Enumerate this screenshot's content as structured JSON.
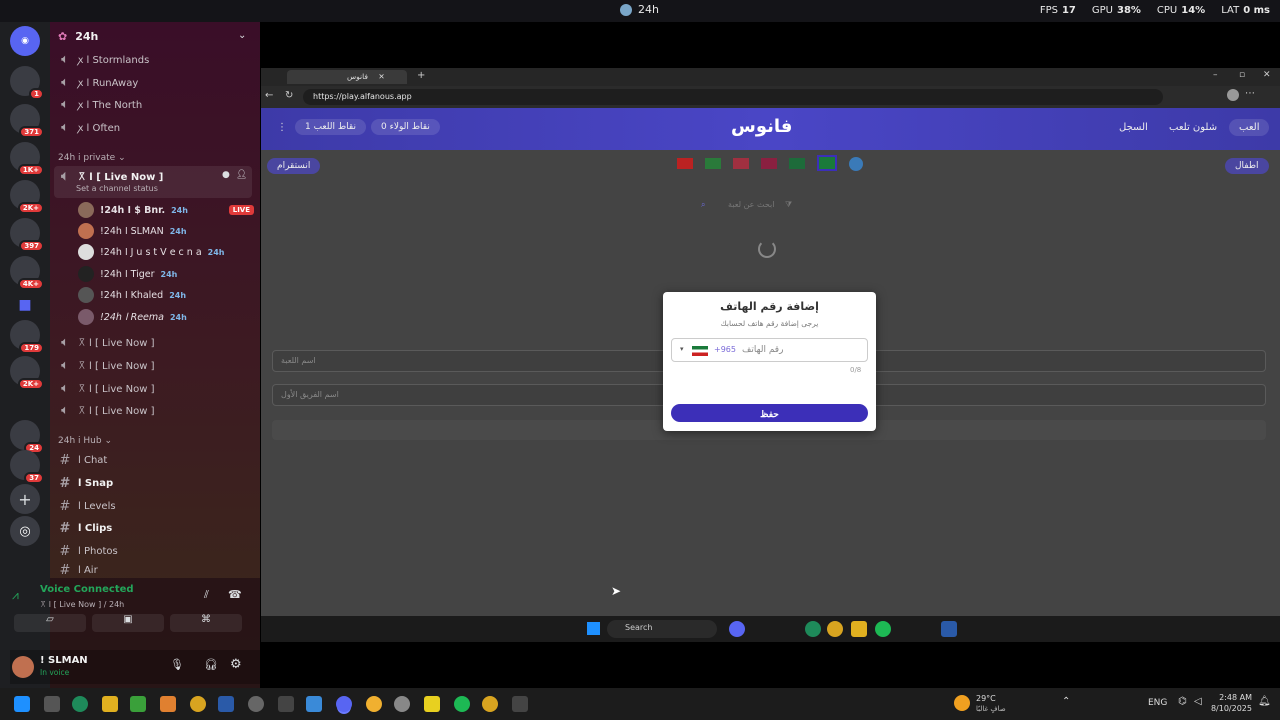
{
  "overlay": {
    "center_label": "24h",
    "stats": [
      {
        "label": "FPS",
        "value": "17"
      },
      {
        "label": "GPU",
        "value": "38%"
      },
      {
        "label": "CPU",
        "value": "14%"
      },
      {
        "label": "LAT",
        "value": "0 ms"
      }
    ]
  },
  "servers": {
    "badges": [
      "1",
      "371",
      "1K+",
      "2K+",
      "397",
      "4K+",
      "179",
      "2K+",
      "24",
      "37"
    ]
  },
  "sidebar": {
    "server_name": "24h",
    "top_channels": [
      "ꭗ ا Stormlands",
      "ꭗ ا RunAway",
      "ꭗ ا The North",
      "ꭗ ا Often"
    ],
    "category_private": "24h i private",
    "active_channel": "꓃ ا [ Live Now ]",
    "channel_status": "Set a channel status",
    "members": [
      {
        "name": "!24h ا $ Bnr.",
        "tag": "24h",
        "live": "LIVE"
      },
      {
        "name": "!24h ا SLMAN",
        "tag": "24h"
      },
      {
        "name": "!24h ا J u s t V e c n a",
        "tag": "24h"
      },
      {
        "name": "!24h ا Tiger",
        "tag": "24h"
      },
      {
        "name": "!24h ا Khaled",
        "tag": "24h"
      },
      {
        "name": "!24h ا Reema",
        "tag": "24h"
      }
    ],
    "live_channels": [
      "꓃ ا [ Live Now ]",
      "꓃ ا [ Live Now ]",
      "꓃ ا [ Live Now ]",
      "꓃ ا [ Live Now ]"
    ],
    "category_hub": "24h i Hub",
    "hub_channels": [
      "ا Chat",
      "ا Snap",
      "ا Levels",
      "ا Clips",
      "ا Photos",
      "ا Air"
    ],
    "voice": {
      "status": "Voice Connected",
      "channel": "꓃ ا [ Live Now ] / 24h"
    },
    "user": {
      "name": "! SLMAN",
      "status": "In voice"
    }
  },
  "browser": {
    "tab_title": "فانوس",
    "url": "https://play.alfanous.app",
    "header": {
      "logo": "فانوس",
      "nav": [
        "العب",
        "شلون تلعب",
        "السجل"
      ],
      "points_play": "نقاط اللعب 1",
      "points_loyalty": "نقاط الولاء 0"
    },
    "buttons": {
      "kids": "اطفال",
      "instagram": "انستقرام"
    },
    "search_placeholder": "ابحث عن لعبة",
    "inputs": {
      "game_name": "اسم اللعبة",
      "team_one": "اسم الفريق الأول"
    }
  },
  "modal": {
    "title": "إضافة رقم الهاتف",
    "subtitle": "يرجى إضافة رقم هاتف لحسابك",
    "country_code": "+965",
    "phone_placeholder": "رقم الهاتف",
    "counter": "0/8",
    "save": "حفظ"
  },
  "win_taskbar": {
    "search": "Search"
  },
  "taskbar": {
    "weather_temp": "29°C",
    "weather_desc": "صافٍ غالبًا",
    "lang": "ENG",
    "time": "2:48 AM",
    "date": "8/10/2025"
  },
  "colors": {
    "accent": "#3c2fb8",
    "header": "#4a46c6",
    "live": "#e03a3a",
    "voice_green": "#23a55a"
  }
}
